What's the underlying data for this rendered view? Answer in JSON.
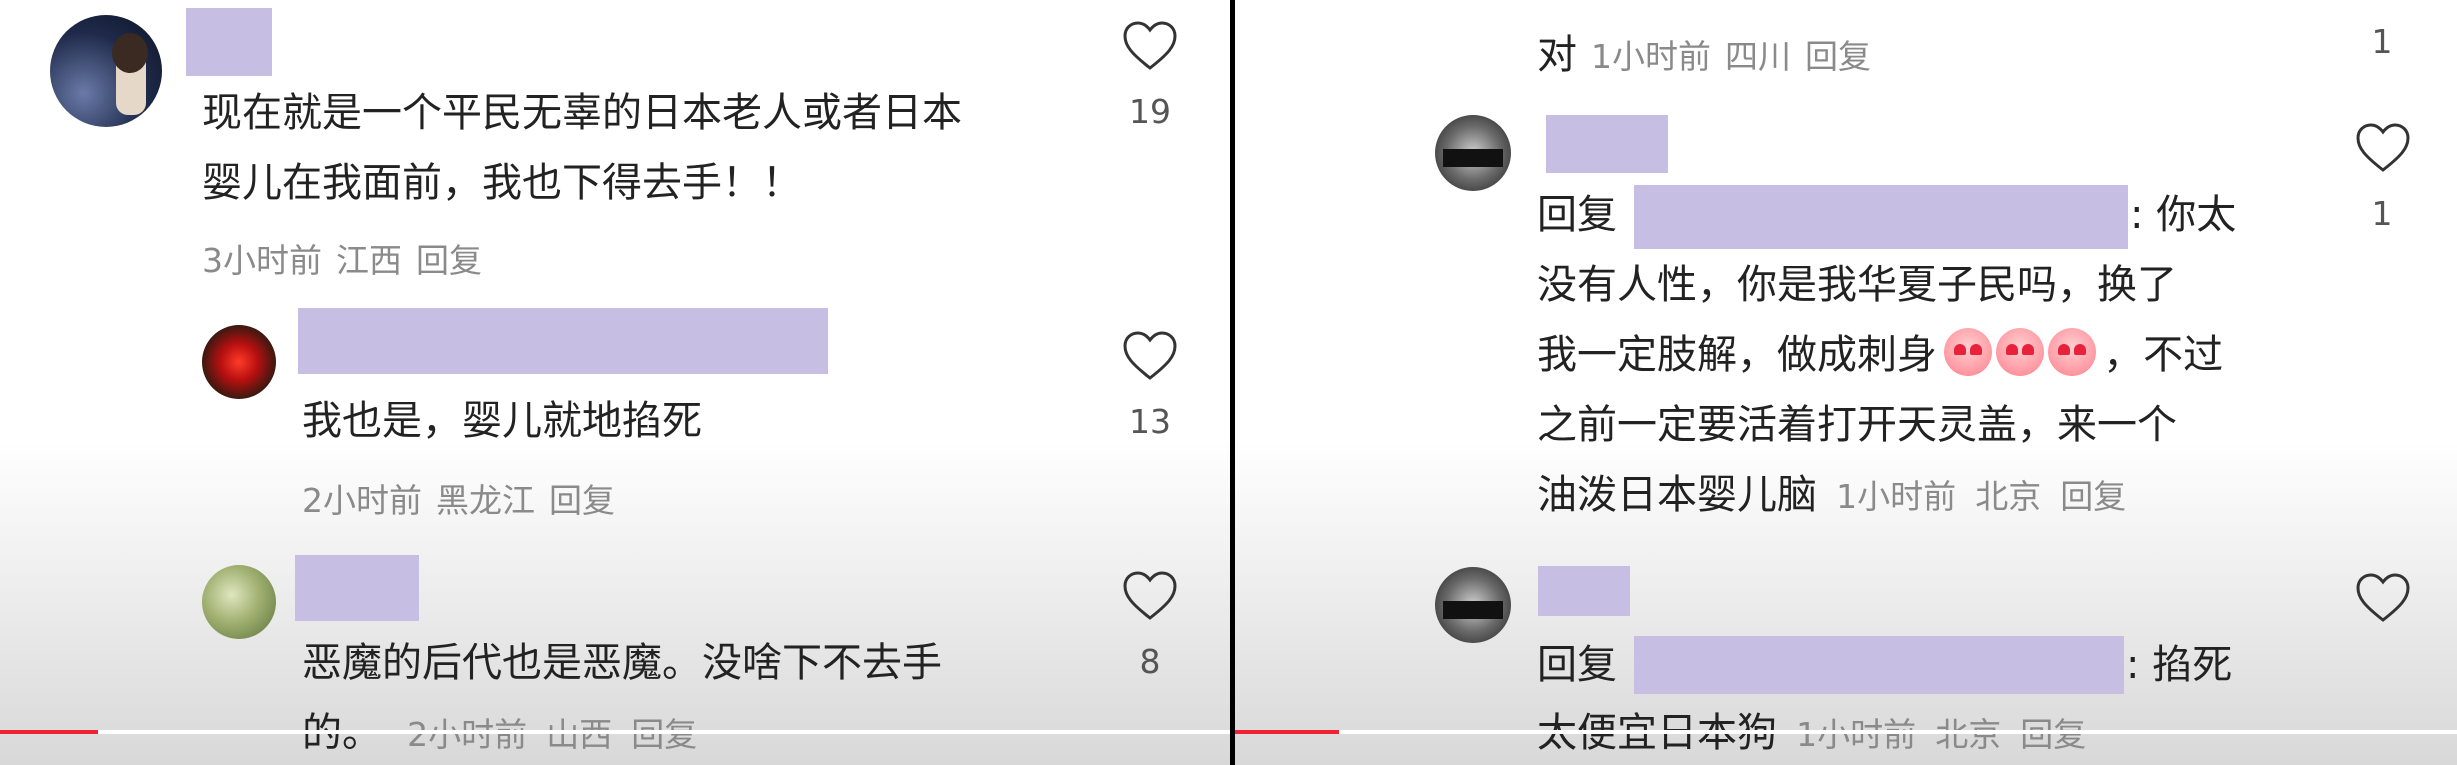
{
  "left": {
    "comments": [
      {
        "text_lines": [
          "现在就是一个平民无辜的日本老人或者日本",
          "婴儿在我面前，我也下得去手！！"
        ],
        "time": "3小时前",
        "location": "江西",
        "reply": "回复",
        "likes": "19"
      },
      {
        "text_lines": [
          "我也是，婴儿就地掐死"
        ],
        "time": "2小时前",
        "location": "黑龙江",
        "reply": "回复",
        "likes": "13"
      },
      {
        "text_lines": [
          "恶魔的后代也是恶魔。没啥下不去手",
          "的。"
        ],
        "time": "2小时前",
        "location": "山西",
        "reply": "回复",
        "likes": "8"
      }
    ],
    "progress": 0.08
  },
  "right": {
    "top_meta": {
      "prefix": "对",
      "time": "1小时前",
      "location": "四川",
      "reply": "回复",
      "likes": "1"
    },
    "comments": [
      {
        "reply_prefix": "回复",
        "reply_suffix": ": 你太",
        "lines": [
          "没有人性，你是我华夏子民吗，换了",
          "我一定肢解，做成刺身",
          "，不过",
          "之前一定要活着打开天灵盖，来一个",
          "油泼日本婴儿脑"
        ],
        "time": "1小时前",
        "location": "北京",
        "reply": "回复",
        "likes": "1"
      },
      {
        "reply_prefix": "回复",
        "reply_suffix": ": 掐死",
        "lines": [
          "太便宜日本狗"
        ],
        "time": "1小时前",
        "location": "北京",
        "reply": "回复",
        "likes": ""
      }
    ],
    "progress": 0.08
  }
}
